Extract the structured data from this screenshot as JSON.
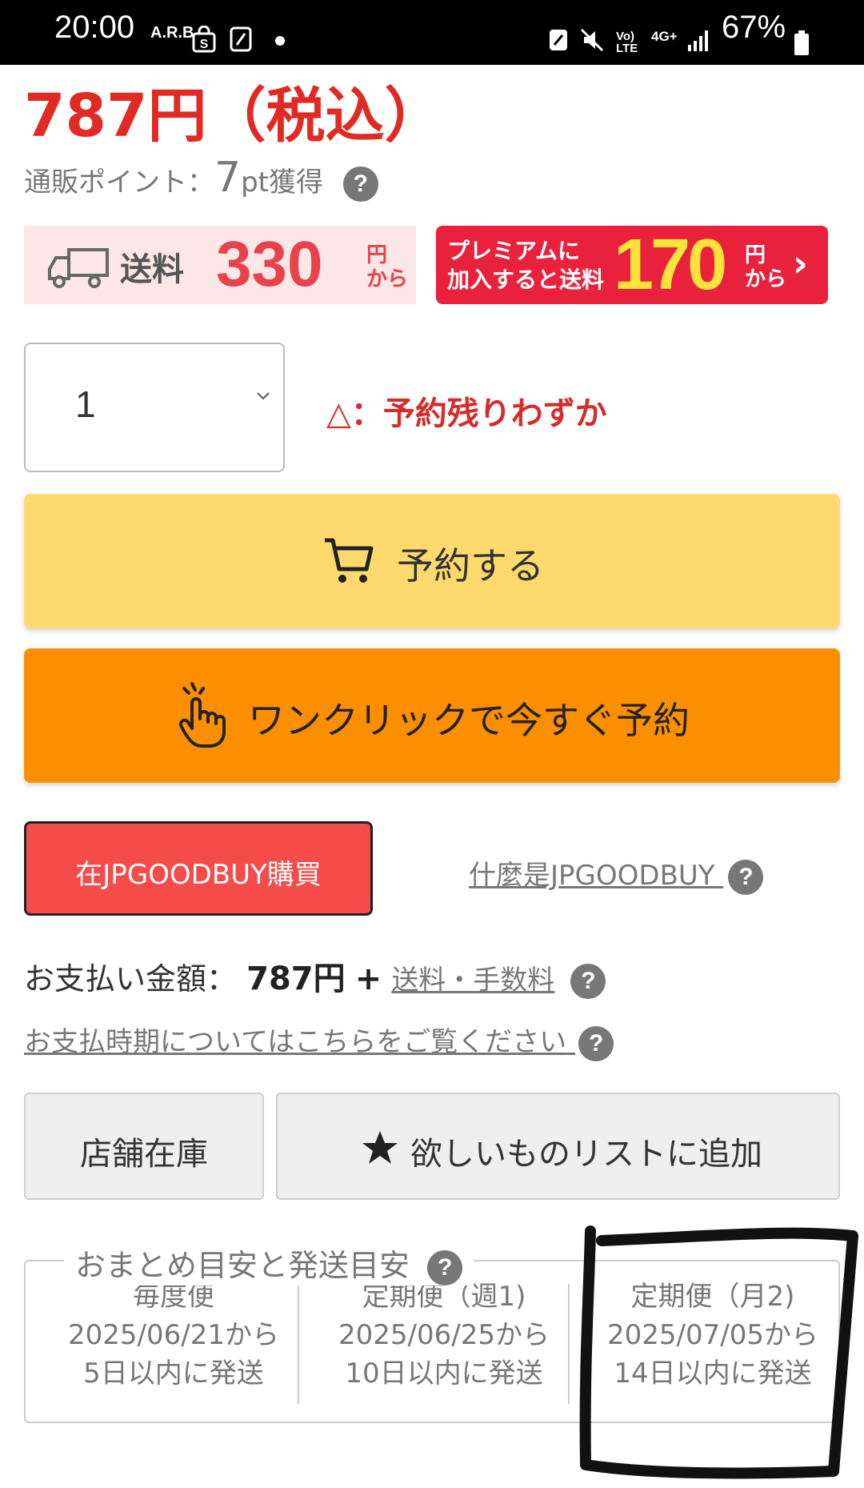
{
  "status_bar": {
    "time": "20:00",
    "carrier_tag": "A.R.B",
    "network": "4G+",
    "volte": "Vo) LTE",
    "battery": "67%"
  },
  "product": {
    "price": "787円（税込）",
    "points_label": "通販ポイント：",
    "points_value": "7",
    "points_unit": "pt獲得"
  },
  "shipping": {
    "label": "送料",
    "amount": "330",
    "unit_line1": "円",
    "unit_line2": "から"
  },
  "premium": {
    "line1": "プレミアムに",
    "line2": "加入すると送料",
    "amount": "170",
    "unit_line1": "円",
    "unit_line2": "から"
  },
  "quantity": {
    "value": "1"
  },
  "stock_status": "△：予約残りわずか",
  "buttons": {
    "reserve": "予約する",
    "one_click": "ワンクリックで今すぐ予約",
    "jpgoodbuy": "在JPGOODBUY購買",
    "what_jpgoodbuy": "什麼是JPGOODBUY",
    "store_stock": "店舗在庫",
    "wishlist": "欲しいものリストに追加"
  },
  "payment": {
    "label": "お支払い金額：",
    "amount": "787円",
    "plus": "+",
    "fees_link": "送料・手数料",
    "timing_link": "お支払時期についてはこちらをご覧ください"
  },
  "schedule": {
    "title": "おまとめ目安と発送目安",
    "columns": [
      {
        "name": "毎度便",
        "date": "2025/06/21から",
        "ship": "5日以内に発送"
      },
      {
        "name": "定期便（週1)",
        "date": "2025/06/25から",
        "ship": "10日以内に発送"
      },
      {
        "name": "定期便（月2)",
        "date": "2025/07/05から",
        "ship": "14日以内に発送"
      }
    ]
  },
  "colors": {
    "price_red": "#e02a23",
    "reserve_yellow": "#fdd96e",
    "oneclick_orange": "#fb8f00",
    "jp_red": "#f54b4b",
    "premium_red": "#e8223c",
    "premium_yellow": "#ffe33b"
  },
  "icons": [
    "truck-icon",
    "cart-icon",
    "tap-hand-icon",
    "star-icon",
    "help-icon",
    "chevron-down-icon",
    "chevron-right-icon"
  ]
}
